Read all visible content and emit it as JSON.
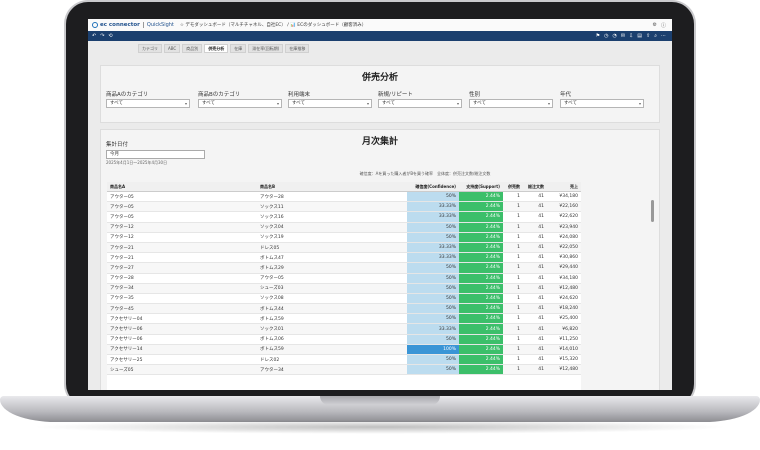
{
  "app": {
    "brand": "ec connector",
    "product": "QuickSight",
    "breadcrumb": "☆ デモダッシュボード（マルチチャネル、自社EC） / 📊 ECのダッシュボード（顧客済み）"
  },
  "tabs": [
    {
      "label": "カテゴリ"
    },
    {
      "label": "ABC"
    },
    {
      "label": "商品別"
    },
    {
      "label": "併売分析"
    },
    {
      "label": "在庫"
    },
    {
      "label": "滞在率(回転期)"
    },
    {
      "label": "在庫推移"
    }
  ],
  "active_tab": "併売分析",
  "panel1": {
    "title": "併売分析",
    "filters": [
      {
        "label": "商品Aのカテゴリ",
        "value": "すべて"
      },
      {
        "label": "商品Bのカテゴリ",
        "value": "すべて"
      },
      {
        "label": "利用端末",
        "value": "すべて"
      },
      {
        "label": "新規/リピート",
        "value": "すべて"
      },
      {
        "label": "性別",
        "value": "すべて"
      },
      {
        "label": "年代",
        "value": "すべて"
      }
    ]
  },
  "panel2": {
    "title": "月次集計",
    "date_label": "集計日付",
    "date_value": "今月",
    "date_range": "2025年4月1日～2025年4月30日",
    "note": "確信度：Aを買った購入者がBを買う確率　全体度：併売注文数/総注文数",
    "columns": [
      "商品名A",
      "商品名B",
      "確信度(Confidence)",
      "支持度(Support)",
      "併売数",
      "総注文数",
      "売上"
    ],
    "rows": [
      [
        "アウター05",
        "アウター28",
        "50%",
        "2.44%",
        "1",
        "41",
        "¥34,180"
      ],
      [
        "アウター05",
        "ソックス11",
        "33.33%",
        "2.44%",
        "1",
        "41",
        "¥22,160"
      ],
      [
        "アウター05",
        "ソックス16",
        "33.33%",
        "2.44%",
        "1",
        "41",
        "¥22,620"
      ],
      [
        "アウター12",
        "ソックス04",
        "50%",
        "2.44%",
        "1",
        "41",
        "¥23,940"
      ],
      [
        "アウター12",
        "ソックス19",
        "50%",
        "2.44%",
        "1",
        "41",
        "¥24,080"
      ],
      [
        "アウター21",
        "ドレス05",
        "33.33%",
        "2.44%",
        "1",
        "41",
        "¥22,050"
      ],
      [
        "アウター21",
        "ボトムス47",
        "33.33%",
        "2.44%",
        "1",
        "41",
        "¥30,860"
      ],
      [
        "アウター27",
        "ボトムス29",
        "50%",
        "2.44%",
        "1",
        "41",
        "¥29,440"
      ],
      [
        "アウター28",
        "アウター05",
        "50%",
        "2.44%",
        "1",
        "41",
        "¥34,180"
      ],
      [
        "アウター34",
        "シューズ03",
        "50%",
        "2.44%",
        "1",
        "41",
        "¥12,480"
      ],
      [
        "アウター35",
        "ソックス08",
        "50%",
        "2.44%",
        "1",
        "41",
        "¥24,620"
      ],
      [
        "アウター45",
        "ボトムス44",
        "50%",
        "2.44%",
        "1",
        "41",
        "¥18,240"
      ],
      [
        "アクセサリー04",
        "ボトムス59",
        "50%",
        "2.44%",
        "1",
        "41",
        "¥25,400"
      ],
      [
        "アクセサリー06",
        "ソックス01",
        "33.33%",
        "2.44%",
        "1",
        "41",
        "¥6,820"
      ],
      [
        "アクセサリー06",
        "ボトムス06",
        "50%",
        "2.44%",
        "1",
        "41",
        "¥11,250"
      ],
      [
        "アクセサリー14",
        "ボトムス59",
        "100%",
        "2.44%",
        "1",
        "41",
        "¥14,010"
      ],
      [
        "アクセサリー25",
        "ドレス02",
        "50%",
        "2.44%",
        "1",
        "41",
        "¥15,320"
      ],
      [
        "シューズ05",
        "アウター34",
        "50%",
        "2.44%",
        "1",
        "41",
        "¥12,480"
      ]
    ]
  },
  "colors": {
    "toolbar": "#1b3f6e",
    "confidence": "#bcdcef",
    "confidence_high": "#3a95d6",
    "support": "#3cbf6a"
  }
}
